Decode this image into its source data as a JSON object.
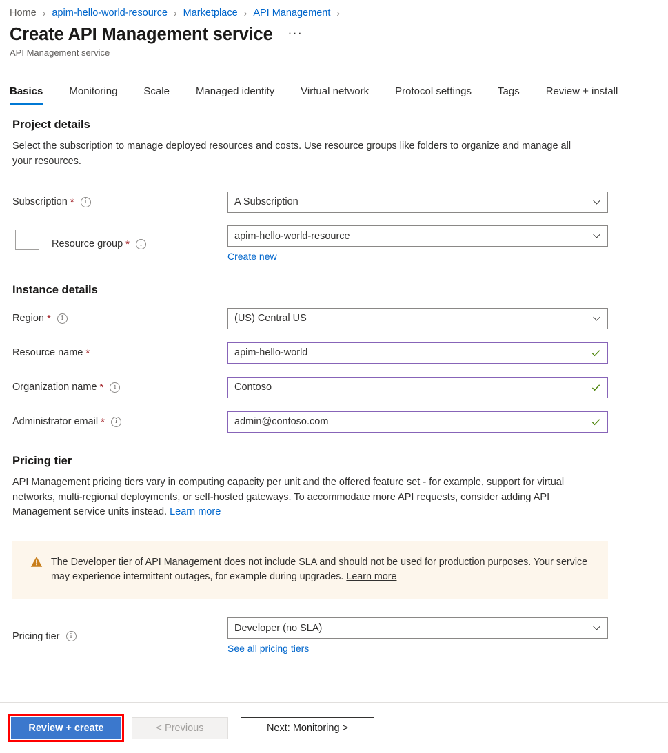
{
  "breadcrumb": {
    "separator": "›",
    "items": [
      {
        "label": "Home"
      },
      {
        "label": "apim-hello-world-resource"
      },
      {
        "label": "Marketplace"
      },
      {
        "label": "API Management"
      }
    ]
  },
  "header": {
    "title": "Create API Management service",
    "subtitle": "API Management service",
    "more_label": "···"
  },
  "tabs": [
    {
      "label": "Basics",
      "active": true
    },
    {
      "label": "Monitoring",
      "active": false
    },
    {
      "label": "Scale",
      "active": false
    },
    {
      "label": "Managed identity",
      "active": false
    },
    {
      "label": "Virtual network",
      "active": false
    },
    {
      "label": "Protocol settings",
      "active": false
    },
    {
      "label": "Tags",
      "active": false
    },
    {
      "label": "Review + install",
      "active": false
    }
  ],
  "project_details": {
    "heading": "Project details",
    "description": "Select the subscription to manage deployed resources and costs. Use resource groups like folders to organize and manage all your resources.",
    "subscription": {
      "label": "Subscription",
      "required": "*",
      "value": "A Subscription",
      "info_icon": "info-icon",
      "chevron_icon": "chevron-down-icon"
    },
    "resource_group": {
      "label": "Resource group",
      "required": "*",
      "value": "apim-hello-world-resource",
      "info_icon": "info-icon",
      "chevron_icon": "chevron-down-icon",
      "create_new_link": "Create new"
    }
  },
  "instance_details": {
    "heading": "Instance details",
    "region": {
      "label": "Region",
      "required": "*",
      "value": "(US) Central US",
      "info_icon": "info-icon",
      "chevron_icon": "chevron-down-icon"
    },
    "resource_name": {
      "label": "Resource name",
      "required": "*",
      "value": "apim-hello-world",
      "valid_icon": "checkmark-icon"
    },
    "organization_name": {
      "label": "Organization name",
      "required": "*",
      "value": "Contoso",
      "info_icon": "info-icon",
      "valid_icon": "checkmark-icon"
    },
    "administrator_email": {
      "label": "Administrator email",
      "required": "*",
      "value": "admin@contoso.com",
      "info_icon": "info-icon",
      "valid_icon": "checkmark-icon"
    }
  },
  "pricing_tier": {
    "heading": "Pricing tier",
    "description": "API Management pricing tiers vary in computing capacity per unit and the offered feature set - for example, support for virtual networks, multi-regional deployments, or self-hosted gateways. To accommodate more API requests, consider adding API Management service units instead.",
    "learn_more": "Learn more",
    "warning": {
      "icon": "warning-triangle-icon",
      "text": "The Developer tier of API Management does not include SLA and should not be used for production purposes. Your service may experience intermittent outages, for example during upgrades.",
      "learn_more": "Learn more"
    },
    "field": {
      "label": "Pricing tier",
      "value": "Developer (no SLA)",
      "info_icon": "info-icon",
      "chevron_icon": "chevron-down-icon"
    },
    "see_all_link": "See all pricing tiers"
  },
  "footer": {
    "review_create": "Review + create",
    "previous": "< Previous",
    "next": "Next: Monitoring >"
  },
  "colors": {
    "accent": "#0078d4",
    "link": "#0066cc",
    "primary_button": "#3b78cd",
    "highlight_outline": "#ff0000",
    "required_asterisk": "#a4262c",
    "valid_border": "#8764b8",
    "valid_check": "#498205",
    "warning_bg": "#fdf6ec",
    "warning_icon": "#c87e1c"
  }
}
